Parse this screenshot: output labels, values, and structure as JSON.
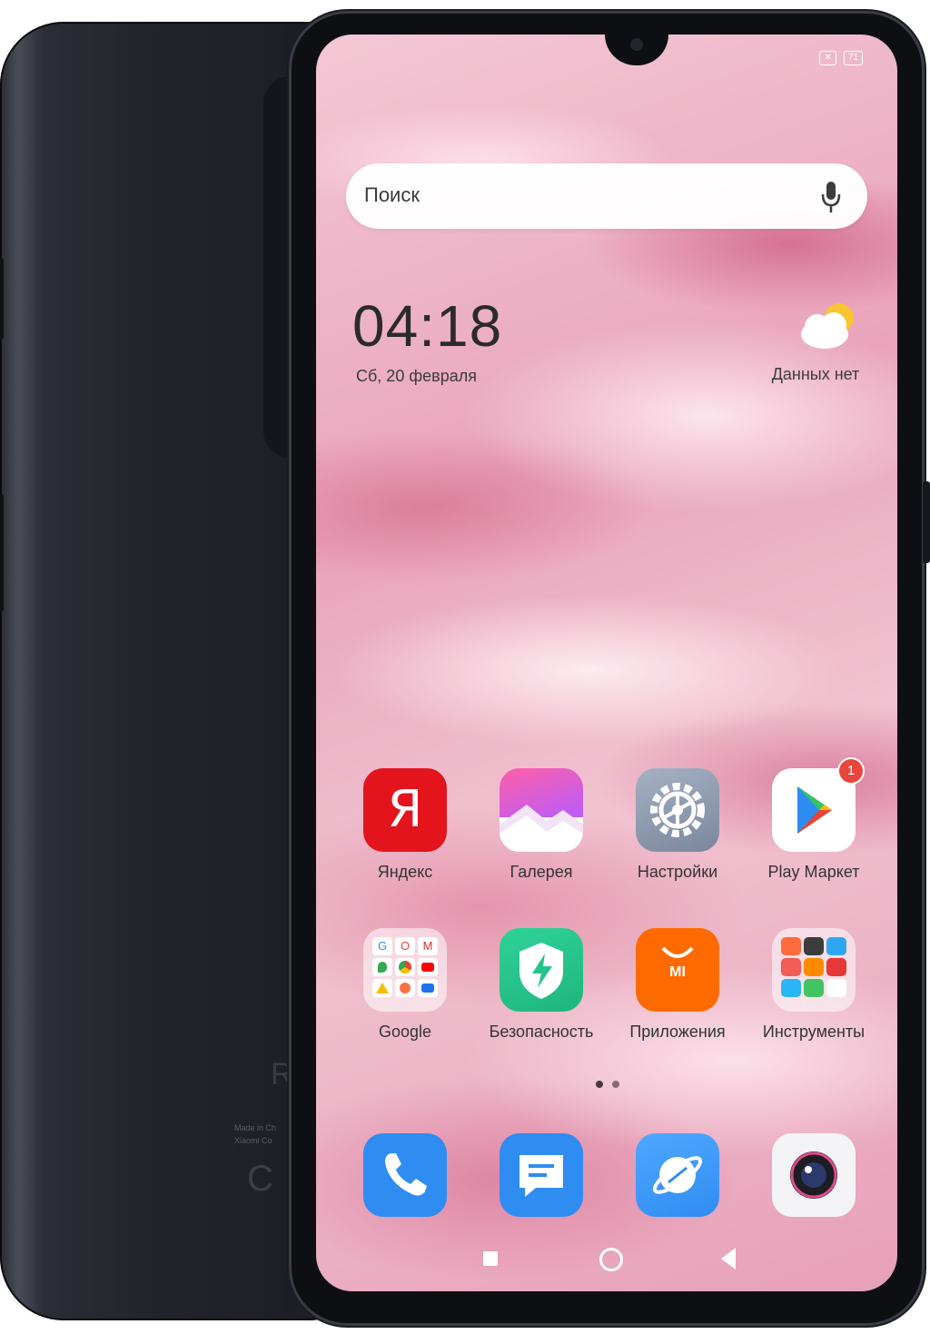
{
  "status_bar": {
    "battery": "71"
  },
  "search": {
    "placeholder": "Поиск"
  },
  "clock": {
    "time": "04:18",
    "date": "Сб, 20 февраля"
  },
  "weather": {
    "text": "Данных нет"
  },
  "apps": [
    {
      "label": "Яндекс",
      "glyph": "Я"
    },
    {
      "label": "Галерея"
    },
    {
      "label": "Настройки"
    },
    {
      "label": "Play Маркет",
      "badge": "1"
    },
    {
      "label": "Google",
      "folder_letters": [
        "G",
        "O",
        "M"
      ]
    },
    {
      "label": "Безопасность"
    },
    {
      "label": "Приложения",
      "glyph": "MI"
    },
    {
      "label": "Инструменты"
    }
  ],
  "dock": [
    {
      "name": "phone-icon"
    },
    {
      "name": "messages-icon"
    },
    {
      "name": "browser-icon"
    },
    {
      "name": "camera-icon"
    }
  ],
  "back_of_phone": {
    "logo_fragment": "R",
    "text_lines": [
      "Made in Ch",
      "Xiaomi Co"
    ]
  },
  "colors": {
    "wallpaper_pink": "#e9a4bb",
    "yandex_red": "#e3141b",
    "badge_red": "#e8453c",
    "security_green": "#25c48a",
    "mi_orange": "#ff6a00",
    "dock_blue": "#2f8cf1"
  }
}
